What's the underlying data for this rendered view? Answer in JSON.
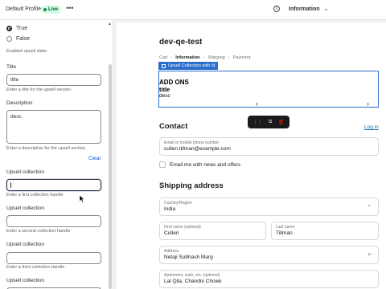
{
  "topbar": {
    "title": "Default Profile",
    "badge": "Live",
    "more": "•••",
    "info_label": "Information",
    "info_chevron": "⌄"
  },
  "left": {
    "radio_true": "True",
    "radio_false": "False",
    "radio_help": "Enabled upsell slider",
    "title_label": "Title",
    "title_value": "title",
    "title_help": "Enter a title for the upsell section.",
    "desc_label": "Description",
    "desc_value": "desc",
    "desc_help": "Enter a description for the upsell section.",
    "clear": "Clear",
    "c1_label": "Upsell collection",
    "c1_help": "Enter a first collection handle",
    "c2_label": "Upsell collection",
    "c2_help": "Enter a second collection handle",
    "c3_label": "Upsell collection",
    "c3_help": "Enter a third collection handle",
    "c4_label": "Upsell collection"
  },
  "preview": {
    "store_name": "dev-qe-test",
    "crumbs": [
      "Cart",
      "Information",
      "Shipping",
      "Payment"
    ],
    "upsell_tag": "Upsell Collection with Id",
    "upsell_heading": "ADD ONS",
    "upsell_title": "title",
    "upsell_desc": "desc",
    "contact_heading": "Contact",
    "login": "Log in",
    "email_label": "Email or mobile phone number",
    "email_value": "cullen.tillman@example.com",
    "email_news": "Email me with news and offers",
    "shipping_heading": "Shipping address",
    "country_label": "Country/Region",
    "country_value": "India",
    "first_label": "First name (optional)",
    "first_value": "Cullen",
    "last_label": "Last name",
    "last_value": "Tillman",
    "address_label": "Address",
    "address_value": "Netaji Subhash Marg",
    "apt_label": "Apartment, suite, etc. (optional)",
    "apt_value": "Lal Qila, Chandni Chowk"
  },
  "icons": {
    "search": "⌕",
    "chev_down": "⌄",
    "chev_left": "‹",
    "chev_right": "›",
    "chev_up": "▲"
  },
  "colors": {
    "accent_blue": "#2c6ecb",
    "live_green": "#29845a",
    "link": "#1773b0",
    "delete_red": "#e51c00"
  }
}
